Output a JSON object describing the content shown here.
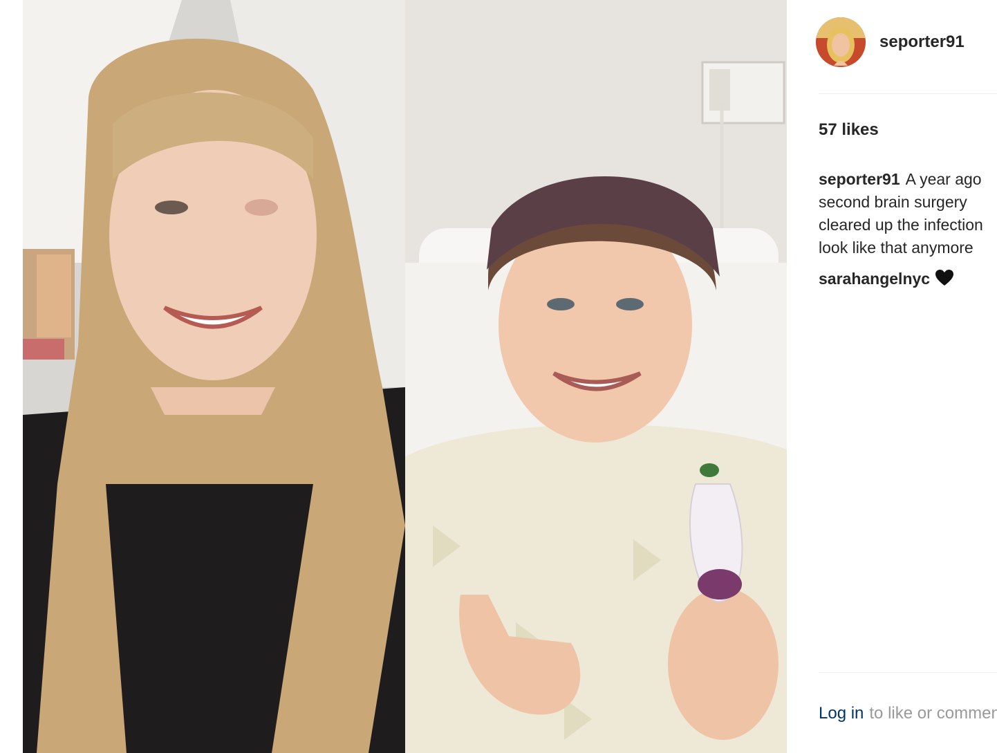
{
  "post": {
    "username": "seporter91",
    "likes": "57 likes",
    "caption": {
      "author": "seporter91",
      "lines": [
        "A year ago",
        "second brain surgery",
        "cleared up the infection",
        "look like that anymore"
      ]
    },
    "comments": [
      {
        "author": "sarahangelnyc",
        "text": "",
        "icon": "heart-icon"
      }
    ],
    "login": {
      "link_label": "Log in",
      "rest": "to like or comment."
    }
  },
  "colors": {
    "username": "#262626",
    "link": "#003569",
    "muted": "#999999",
    "divider": "#efefef"
  }
}
